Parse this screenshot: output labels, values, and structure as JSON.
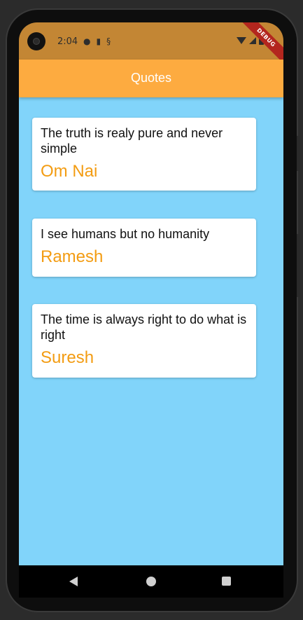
{
  "status_bar": {
    "time": "2:04",
    "debug_label": "DEBUG",
    "icons": [
      "camera-icon",
      "chat-icon",
      "sd-card-icon",
      "sim-icon",
      "wifi-icon",
      "signal-icon",
      "battery-icon"
    ]
  },
  "app_bar": {
    "title": "Quotes"
  },
  "quotes": [
    {
      "text": "The truth is realy pure and never simple",
      "author": "Om Nai"
    },
    {
      "text": "I see humans but no humanity",
      "author": "Ramesh"
    },
    {
      "text": "The time is always right to do what is right",
      "author": "Suresh"
    }
  ],
  "nav_bar": {
    "icons": [
      "back-icon",
      "home-icon",
      "recents-icon"
    ]
  },
  "colors": {
    "status_bar": "#c38634",
    "app_bar": "#fdab40",
    "background": "#81d4fa",
    "author_text": "#f39c12",
    "card": "#ffffff"
  }
}
